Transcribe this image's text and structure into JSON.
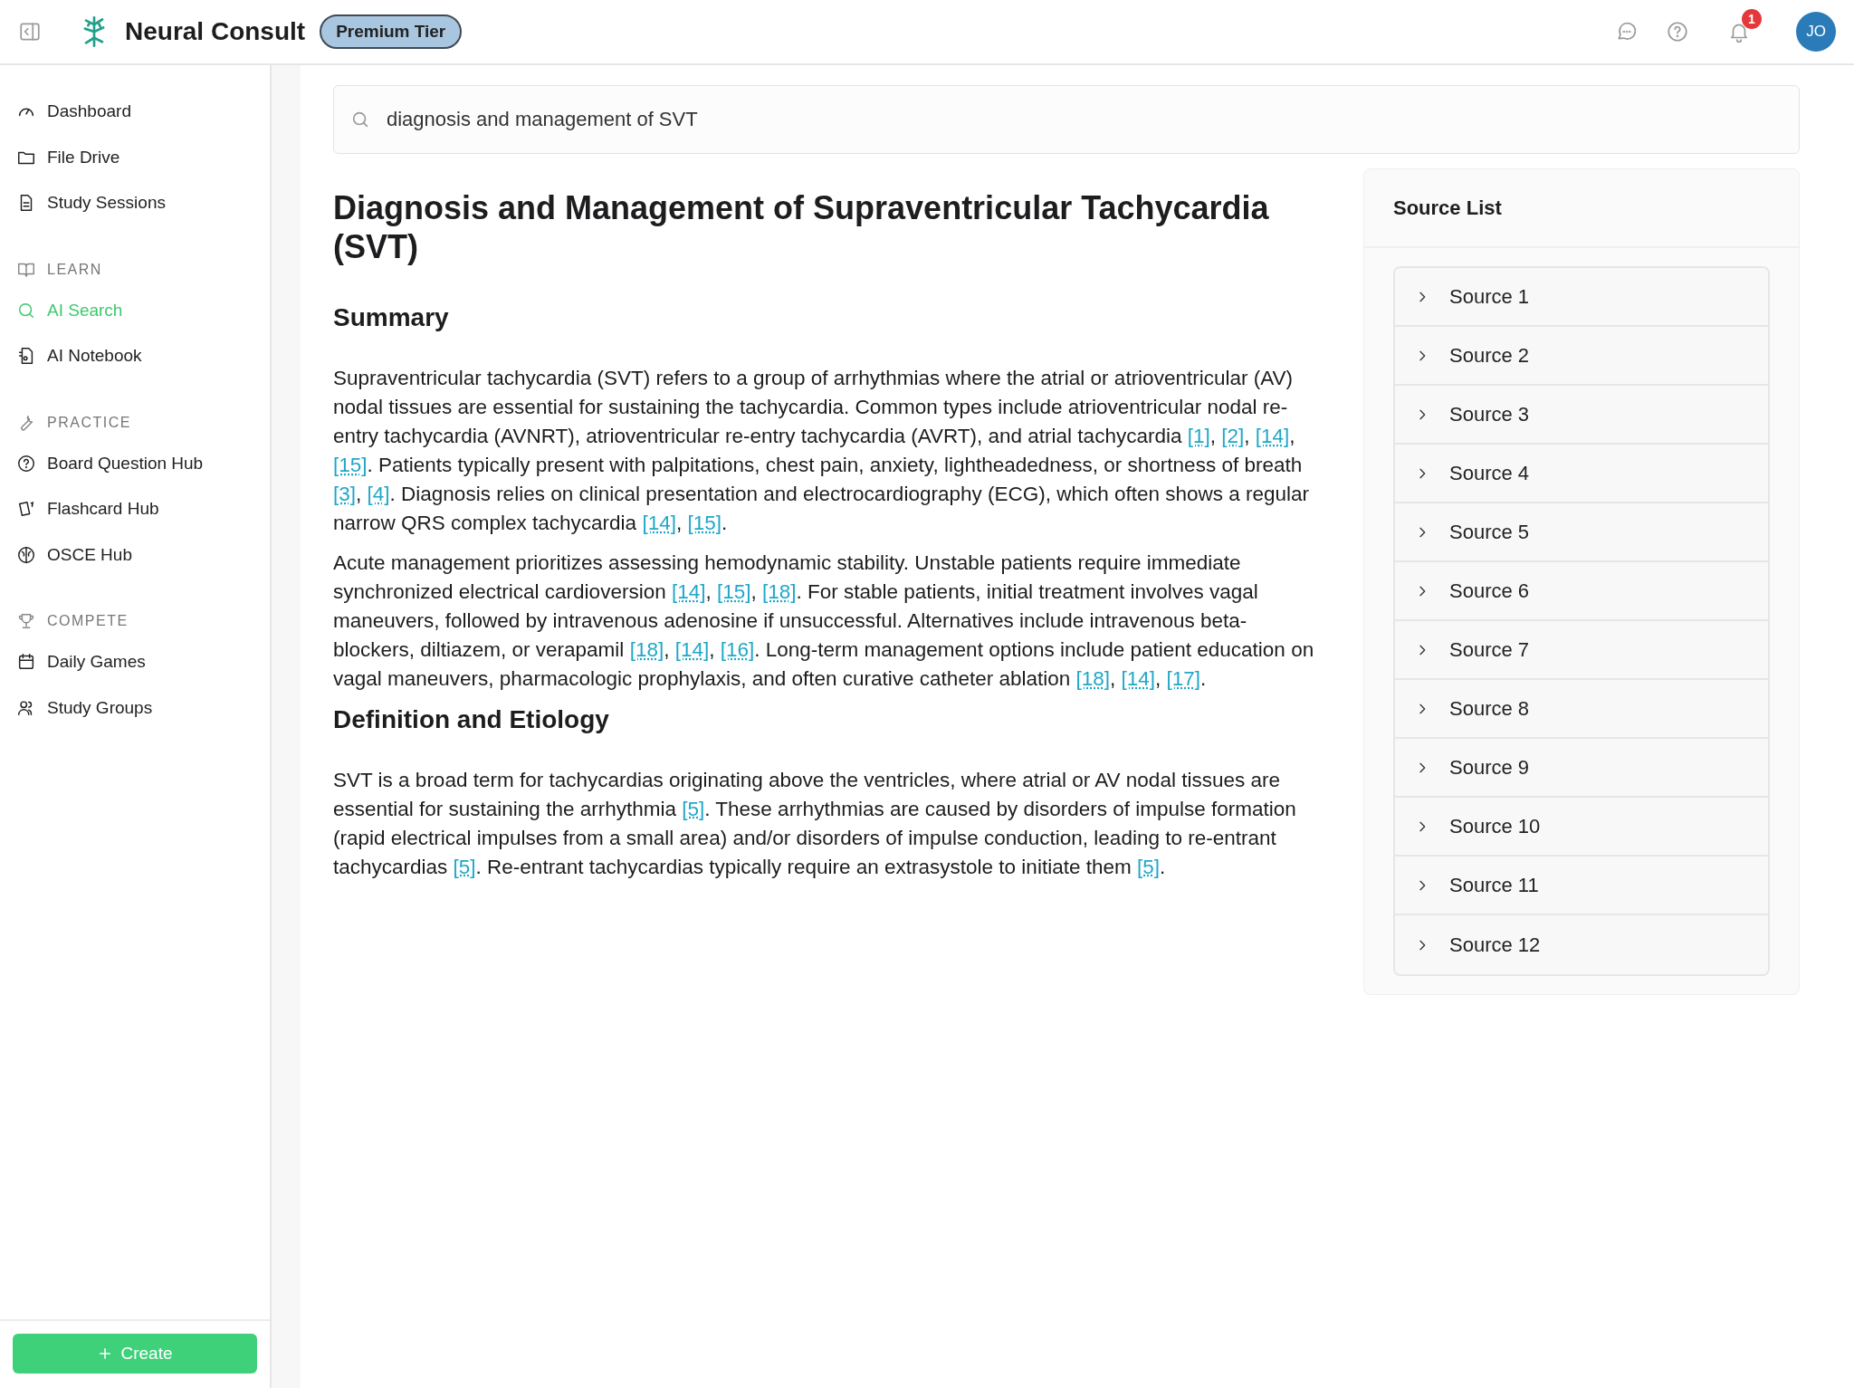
{
  "header": {
    "brand": "Neural Consult",
    "tier_badge": "Premium Tier",
    "notification_count": "1",
    "avatar_initials": "JO"
  },
  "sidebar": {
    "sections": [
      {
        "items": [
          {
            "label": "Dashboard",
            "selected": false
          },
          {
            "label": "File Drive",
            "selected": false
          },
          {
            "label": "Study Sessions",
            "selected": false
          }
        ]
      },
      {
        "heading": "LEARN",
        "items": [
          {
            "label": "AI Search",
            "selected": true
          },
          {
            "label": "AI Notebook",
            "selected": false
          }
        ]
      },
      {
        "heading": "PRACTICE",
        "items": [
          {
            "label": "Board Question Hub",
            "selected": false
          },
          {
            "label": "Flashcard Hub",
            "selected": false
          },
          {
            "label": "OSCE Hub",
            "selected": false
          }
        ]
      },
      {
        "heading": "COMPETE",
        "items": [
          {
            "label": "Daily Games",
            "selected": false
          },
          {
            "label": "Study Groups",
            "selected": false
          }
        ]
      }
    ],
    "create_button": "Create"
  },
  "search": {
    "value": "diagnosis and management of SVT"
  },
  "article": {
    "title": "Diagnosis and Management of Supraventricular Tachycardia (SVT)",
    "sections": [
      {
        "heading": "Summary",
        "paragraphs": [
          [
            {
              "kind": "text",
              "text": "Supraventricular tachycardia (SVT) refers to a group of arrhythmias where the atrial or atrioventricular (AV) nodal tissues are essential for sustaining the tachycardia. Common types include atrioventricular nodal re-entry tachycardia (AVNRT), atrioventricular re-entry tachycardia (AVRT), and atrial tachycardia "
            },
            {
              "kind": "cite",
              "text": "[1]"
            },
            {
              "kind": "text",
              "text": ", "
            },
            {
              "kind": "cite",
              "text": "[2]"
            },
            {
              "kind": "text",
              "text": ", "
            },
            {
              "kind": "cite",
              "text": "[14]"
            },
            {
              "kind": "text",
              "text": ", "
            },
            {
              "kind": "cite",
              "text": "[15]"
            },
            {
              "kind": "text",
              "text": ". Patients typically present with palpitations, chest pain, anxiety, lightheadedness, or shortness of breath "
            },
            {
              "kind": "cite",
              "text": "[3]"
            },
            {
              "kind": "text",
              "text": ", "
            },
            {
              "kind": "cite",
              "text": "[4]"
            },
            {
              "kind": "text",
              "text": ". Diagnosis relies on clinical presentation and electrocardiography (ECG), which often shows a regular narrow QRS complex tachycardia "
            },
            {
              "kind": "cite",
              "text": "[14]"
            },
            {
              "kind": "text",
              "text": ", "
            },
            {
              "kind": "cite",
              "text": "[15]"
            },
            {
              "kind": "text",
              "text": "."
            }
          ],
          [
            {
              "kind": "text",
              "text": "Acute management prioritizes assessing hemodynamic stability. Unstable patients require immediate synchronized electrical cardioversion "
            },
            {
              "kind": "cite",
              "text": "[14]"
            },
            {
              "kind": "text",
              "text": ", "
            },
            {
              "kind": "cite",
              "text": "[15]"
            },
            {
              "kind": "text",
              "text": ", "
            },
            {
              "kind": "cite",
              "text": "[18]"
            },
            {
              "kind": "text",
              "text": ". For stable patients, initial treatment involves vagal maneuvers, followed by intravenous adenosine if unsuccessful. Alternatives include intravenous beta-blockers, diltiazem, or verapamil "
            },
            {
              "kind": "cite",
              "text": "[18]"
            },
            {
              "kind": "text",
              "text": ", "
            },
            {
              "kind": "cite",
              "text": "[14]"
            },
            {
              "kind": "text",
              "text": ", "
            },
            {
              "kind": "cite",
              "text": "[16]"
            },
            {
              "kind": "text",
              "text": ". Long-term management options include patient education on vagal maneuvers, pharmacologic prophylaxis, and often curative catheter ablation "
            },
            {
              "kind": "cite",
              "text": "[18]"
            },
            {
              "kind": "text",
              "text": ", "
            },
            {
              "kind": "cite",
              "text": "[14]"
            },
            {
              "kind": "text",
              "text": ", "
            },
            {
              "kind": "cite",
              "text": "[17]"
            },
            {
              "kind": "text",
              "text": "."
            }
          ]
        ]
      },
      {
        "heading": "Definition and Etiology",
        "paragraphs": [
          [
            {
              "kind": "text",
              "text": "SVT is a broad term for tachycardias originating above the ventricles, where atrial or AV nodal tissues are essential for sustaining the arrhythmia "
            },
            {
              "kind": "cite",
              "text": "[5]"
            },
            {
              "kind": "text",
              "text": ". These arrhythmias are caused by disorders of impulse formation (rapid electrical impulses from a small area) and/or disorders of impulse conduction, leading to re-entrant tachycardias "
            },
            {
              "kind": "cite",
              "text": "[5]"
            },
            {
              "kind": "text",
              "text": ". Re-entrant tachycardias typically require an extrasystole to initiate them "
            },
            {
              "kind": "cite",
              "text": "[5]"
            },
            {
              "kind": "text",
              "text": "."
            }
          ]
        ]
      }
    ]
  },
  "source_list": {
    "title": "Source List",
    "sources": [
      {
        "label": "Source 1",
        "expanded": false
      },
      {
        "label": "Source 2",
        "expanded": false
      },
      {
        "label": "Source 3",
        "expanded": false
      },
      {
        "label": "Source 4",
        "expanded": false
      },
      {
        "label": "Source 5",
        "expanded": false
      },
      {
        "label": "Source 6",
        "expanded": false
      },
      {
        "label": "Source 7",
        "expanded": false
      },
      {
        "label": "Source 8",
        "expanded": false
      },
      {
        "label": "Source 9",
        "expanded": false
      },
      {
        "label": "Source 10",
        "expanded": false
      },
      {
        "label": "Source 11",
        "expanded": false
      },
      {
        "label": "Source 12",
        "expanded": false
      }
    ]
  }
}
